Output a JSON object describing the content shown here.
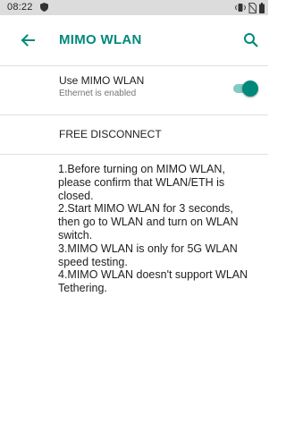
{
  "status_bar": {
    "time": "08:22",
    "icons": [
      "shield-icon",
      "vibrate-icon",
      "no-sim-icon",
      "battery-icon"
    ]
  },
  "app_bar": {
    "title": "MIMO WLAN",
    "back_icon": "arrow-back-icon",
    "search_icon": "search-icon"
  },
  "preference": {
    "title": "Use MIMO WLAN",
    "summary": "Ethernet is enabled",
    "enabled": true
  },
  "free_disconnect": {
    "label": "FREE DISCONNECT"
  },
  "info": {
    "lines": [
      "1.Before turning on MIMO WLAN,",
      "please confirm that WLAN/ETH is",
      "closed.",
      "2.Start MIMO WLAN for 3 seconds,",
      "then go to WLAN and turn on WLAN",
      "switch.",
      "3.MIMO WLAN is only for 5G WLAN",
      "speed testing.",
      "4.MIMO WLAN doesn't support WLAN",
      "Tethering."
    ]
  },
  "colors": {
    "accent": "#00897b",
    "accent_light": "#80cbc4",
    "status_bar_bg": "#dcdcdc",
    "divider": "#e0e0e0"
  }
}
